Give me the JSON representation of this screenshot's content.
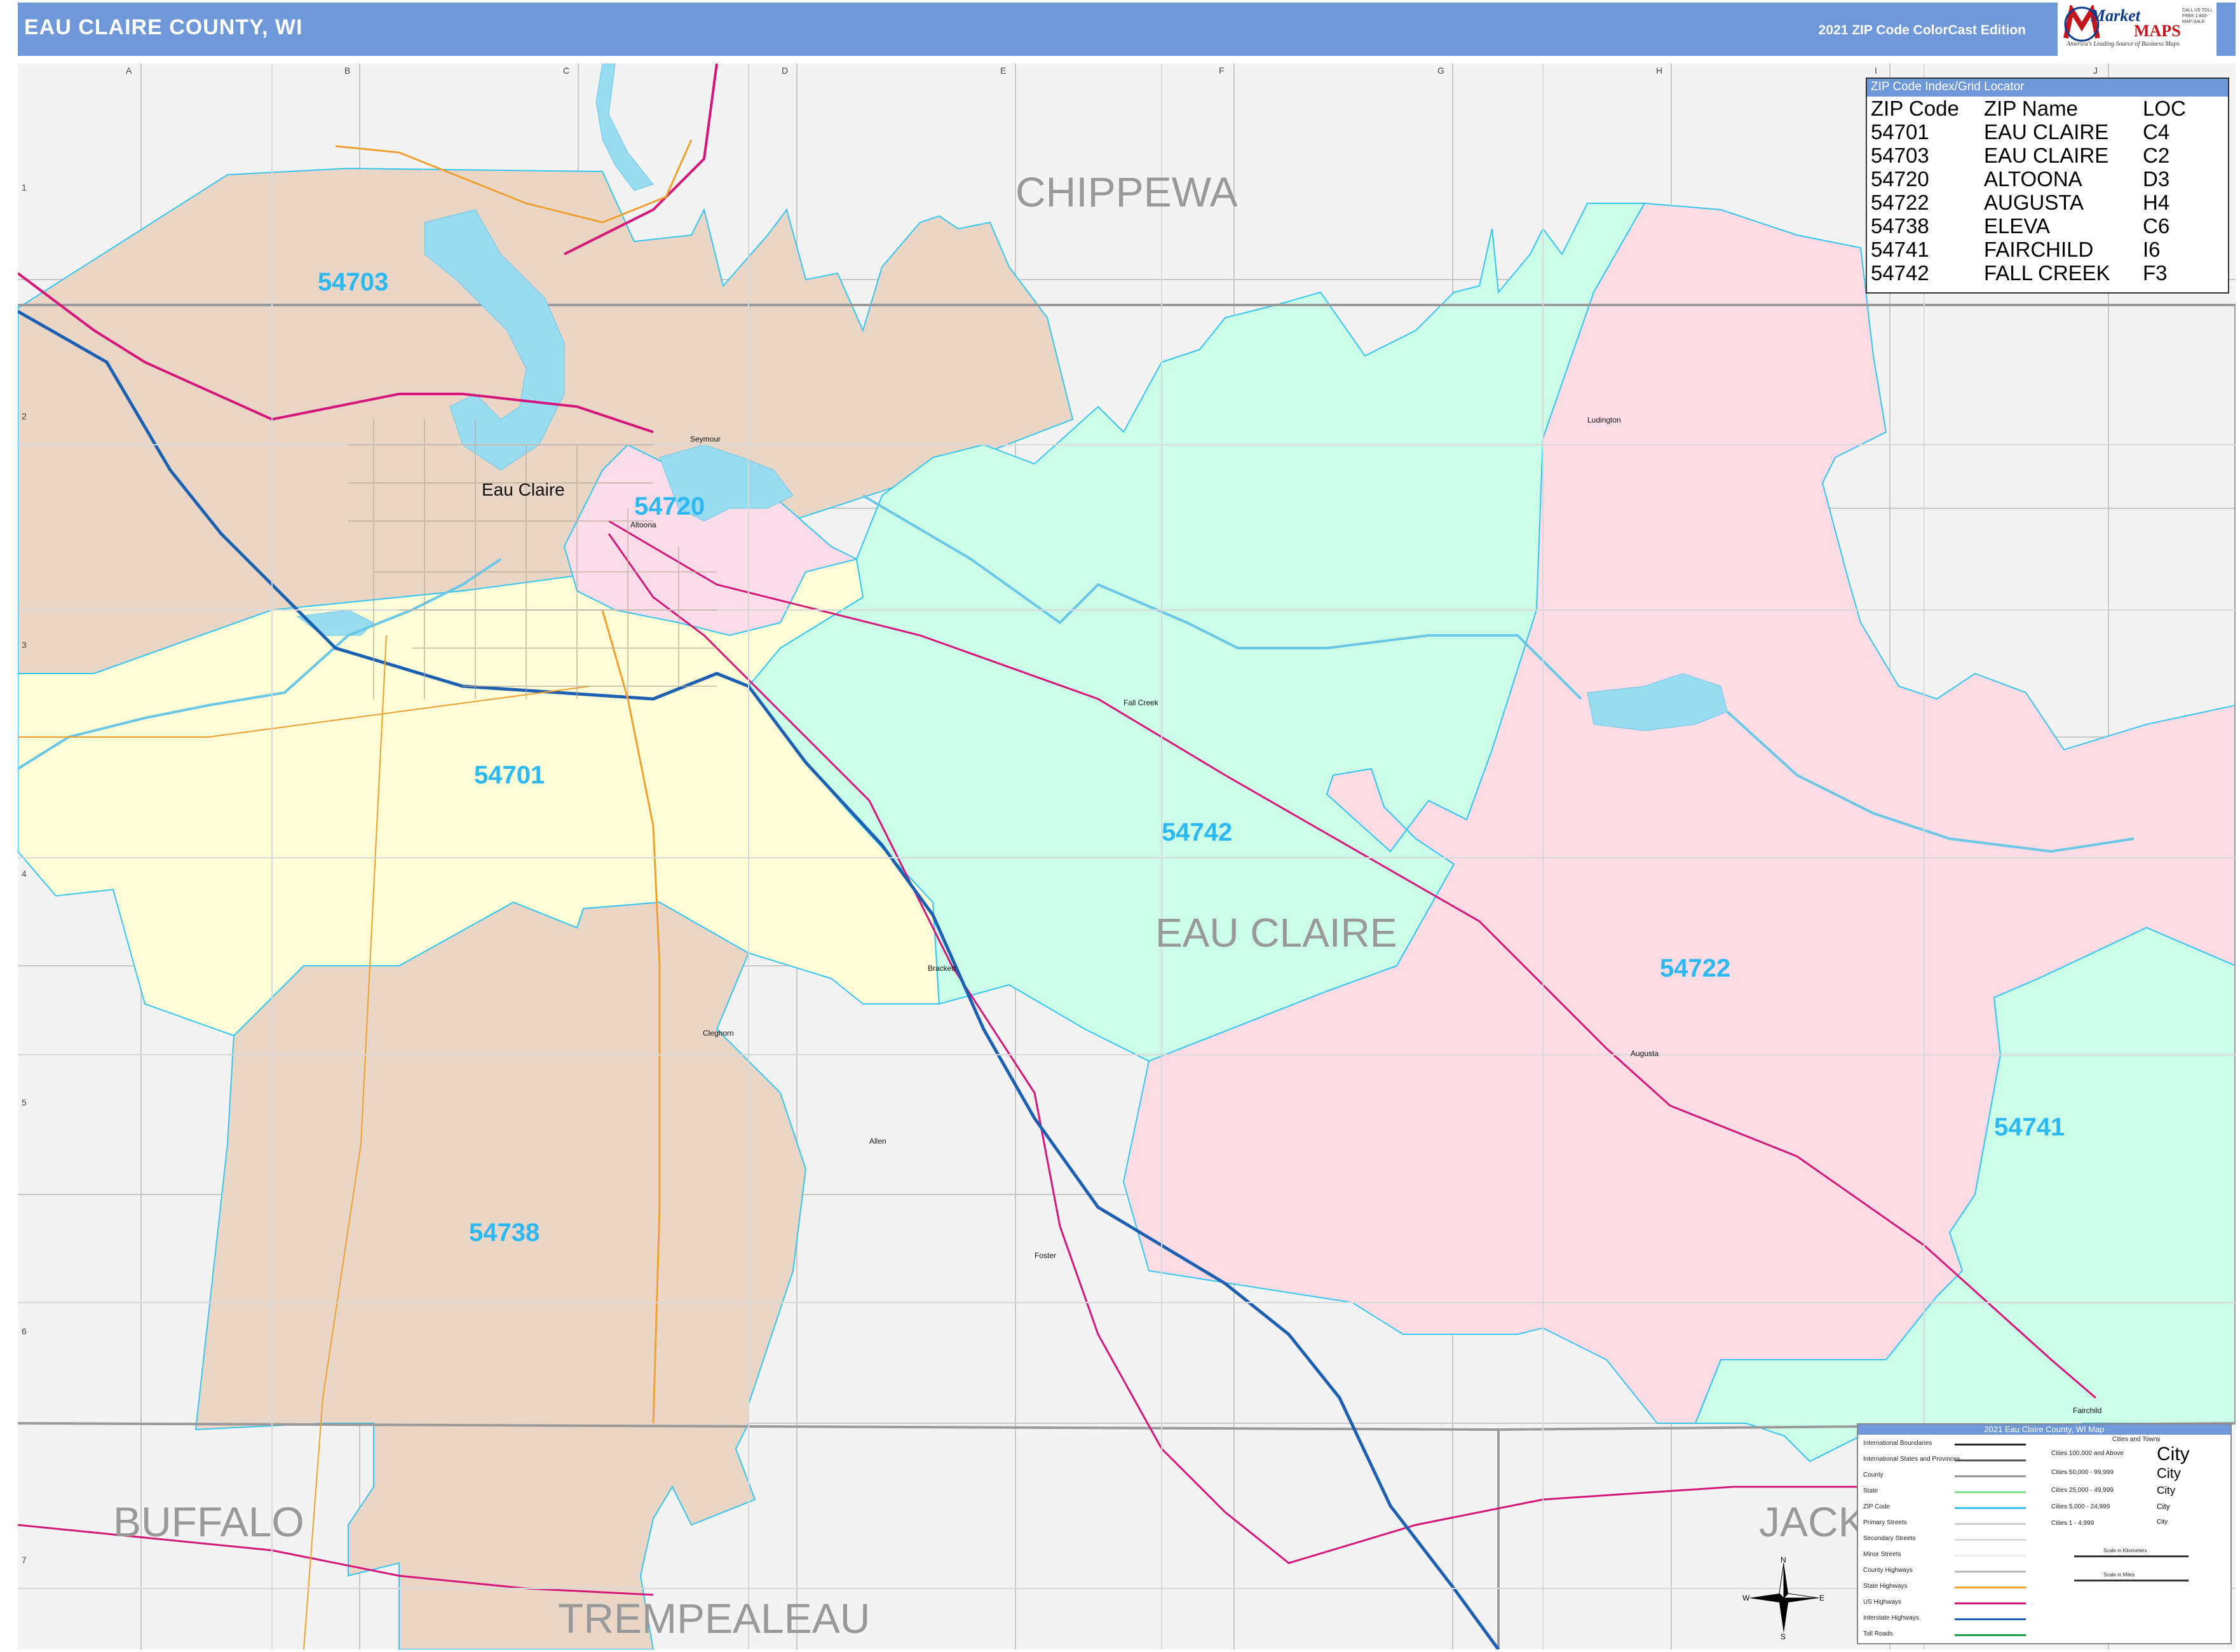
{
  "header": {
    "title": "EAU CLAIRE COUNTY, WI",
    "edition": "2021 ZIP Code ColorCast Edition",
    "logo_name": "Market",
    "logo_name2": "MAPS",
    "logo_tagline": "America's Leading Source of Business Maps",
    "logo_phone": "CALL US TOLL FREE 1-800-MAP-SALE"
  },
  "grid": {
    "columns": [
      "A",
      "B",
      "C",
      "D",
      "E",
      "F",
      "G",
      "H",
      "I",
      "J"
    ],
    "rows": [
      "1",
      "2",
      "3",
      "4",
      "5",
      "6",
      "7"
    ]
  },
  "map_labels": {
    "county_center": "EAU CLAIRE",
    "neighbors": [
      "CHIPPEWA",
      "BUFFALO",
      "TREMPEALEAU",
      "JACK"
    ],
    "zips": [
      "54703",
      "54720",
      "54701",
      "54742",
      "54722",
      "54741",
      "54738"
    ],
    "cities": [
      "Eau Claire",
      "Altoona",
      "Seymour",
      "Fall Creek",
      "Ludington",
      "Brackett",
      "Cleghorn",
      "Allen",
      "Foster",
      "Augusta",
      "Fairchild"
    ]
  },
  "zip_index": {
    "heading": "ZIP Code Index/Grid Locator",
    "columns": [
      "ZIP Code",
      "ZIP Name",
      "LOC"
    ],
    "rows": [
      [
        "54701",
        "EAU CLAIRE",
        "C4"
      ],
      [
        "54703",
        "EAU CLAIRE",
        "C2"
      ],
      [
        "54720",
        "ALTOONA",
        "D3"
      ],
      [
        "54722",
        "AUGUSTA",
        "H4"
      ],
      [
        "54738",
        "ELEVA",
        "C6"
      ],
      [
        "54741",
        "FAIRCHILD",
        "I6"
      ],
      [
        "54742",
        "FALL CREEK",
        "F3"
      ]
    ]
  },
  "legend": {
    "title": "2021 Eau Claire County, WI Map",
    "items": [
      {
        "label": "International Boundaries",
        "color": "#222222"
      },
      {
        "label": "International States and Provinces",
        "color": "#555555"
      },
      {
        "label": "County",
        "color": "#999999"
      },
      {
        "label": "State",
        "color": "#7ee08a"
      },
      {
        "label": "ZIP Code",
        "color": "#37c6f0"
      },
      {
        "label": "Primary Streets",
        "color": "#cccccc"
      },
      {
        "label": "Secondary Streets",
        "color": "#dddddd"
      },
      {
        "label": "Minor Streets",
        "color": "#eeeeee"
      },
      {
        "label": "County Highways",
        "color": "#bbbbbb"
      },
      {
        "label": "State Highways",
        "color": "#f0a030"
      },
      {
        "label": "US Highways",
        "color": "#d6177a"
      },
      {
        "label": "Interstate Highways",
        "color": "#1d5fb0"
      },
      {
        "label": "Toll Roads",
        "color": "#1aa04a"
      }
    ],
    "city_heading": "Cities and Towns",
    "city_sizes": [
      {
        "label": "Cities 100,000 and Above",
        "sample": "City"
      },
      {
        "label": "Cities 50,000 - 99,999",
        "sample": "City"
      },
      {
        "label": "Cities 25,000 - 49,999",
        "sample": "City"
      },
      {
        "label": "Cities 5,000 - 24,999",
        "sample": "City"
      },
      {
        "label": "Cities 1 - 4,999",
        "sample": "City"
      }
    ],
    "scale_km": "Scale in Kilometers",
    "scale_mi": "Scale in Miles"
  },
  "compass": {
    "n": "N",
    "s": "S",
    "e": "E",
    "w": "W"
  },
  "colors": {
    "header": "#6e98d8",
    "zip_54703": "#e9d6c6",
    "zip_54720": "#fadde8",
    "zip_54701": "#fdfdd8",
    "zip_54742": "#cbfde8",
    "zip_54722": "#fddde5",
    "zip_54741": "#cbfde8",
    "zip_54738": "#e9d6c6",
    "outside": "#f3f3f3",
    "water": "#99dcf2",
    "zip_label": "#2cb8f0"
  }
}
